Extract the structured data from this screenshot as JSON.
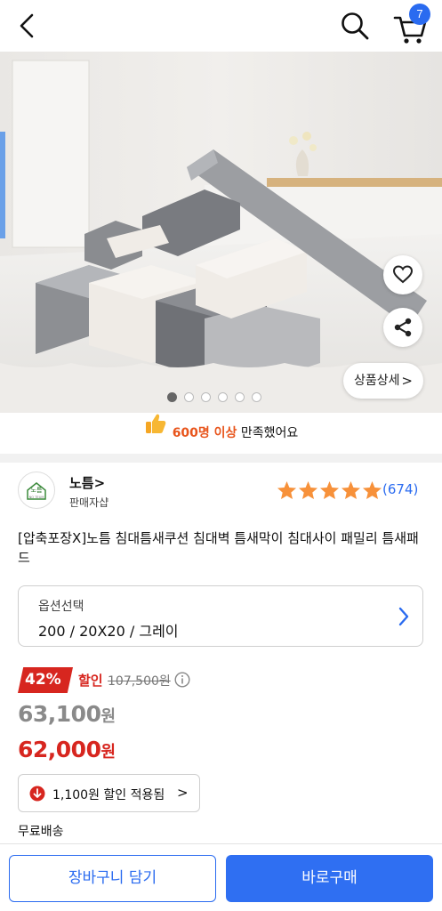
{
  "header": {
    "cart_count": "7"
  },
  "hero": {
    "detail_label": "상품상세",
    "detail_chevron": ">",
    "slide_count": 6,
    "active_slide": 1
  },
  "satisfaction": {
    "highlight": "600명 이상",
    "rest": " 만족했어요"
  },
  "seller": {
    "logo_text": "노틈",
    "logo_sub": "NO TEUM",
    "name": "노틈>",
    "type": "판매자샵"
  },
  "rating": {
    "stars": 5,
    "count": "(674)"
  },
  "product": {
    "title": "[압축포장X]노틈 침대틈새쿠션 침대벽 틈새막이 침대사이 패밀리 틈새패드"
  },
  "option": {
    "label": "옵션선택",
    "value": "200 / 20X20 / 그레이"
  },
  "price": {
    "discount_rate": "42%",
    "discount_label": "할인",
    "original": "107,500원",
    "price_num": "63,100",
    "final_num": "62,000",
    "won": "원",
    "coupon_text": "1,100원  할인 적용됨",
    "coupon_chevron": ">",
    "shipping": "무료배송"
  },
  "buttons": {
    "cart": "장바구니 담기",
    "buy": "바로구매"
  },
  "colors": {
    "accent_blue": "#2a6bf0",
    "sale_red": "#d7261f",
    "highlight_orange": "#e8551c"
  }
}
